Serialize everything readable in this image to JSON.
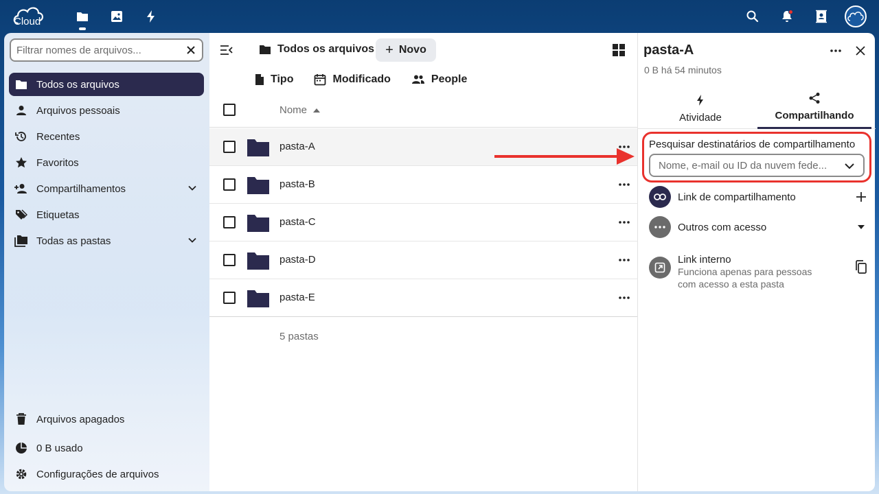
{
  "app": {
    "logo_text": "Cloud",
    "colors": {
      "accent": "#2b2a4e",
      "header": "#0b3d73",
      "highlight": "#e9322d"
    }
  },
  "topbar": {
    "apps": [
      "files-icon",
      "photos-icon",
      "activity-icon"
    ],
    "right": [
      "search-icon",
      "notifications-icon",
      "contacts-icon",
      "avatar"
    ]
  },
  "sidebar": {
    "filter_placeholder": "Filtrar nomes de arquivos...",
    "items": [
      {
        "label": "Todos os arquivos",
        "icon": "folder-icon",
        "active": true
      },
      {
        "label": "Arquivos pessoais",
        "icon": "person-icon"
      },
      {
        "label": "Recentes",
        "icon": "history-icon"
      },
      {
        "label": "Favoritos",
        "icon": "star-icon"
      },
      {
        "label": "Compartilhamentos",
        "icon": "share-person-icon",
        "expandable": true
      },
      {
        "label": "Etiquetas",
        "icon": "tag-icon"
      },
      {
        "label": "Todas as pastas",
        "icon": "folders-icon",
        "expandable": true
      }
    ],
    "footer": [
      {
        "label": "Arquivos apagados",
        "icon": "trash-icon"
      },
      {
        "label": "0 B usado",
        "icon": "pie-chart-icon"
      },
      {
        "label": "Configurações de arquivos",
        "icon": "gear-icon"
      }
    ]
  },
  "main": {
    "breadcrumb": "Todos os arquivos",
    "new_label": "Novo",
    "filters": [
      "Tipo",
      "Modificado",
      "People"
    ],
    "column_name": "Nome",
    "rows": [
      "pasta-A",
      "pasta-B",
      "pasta-C",
      "pasta-D",
      "pasta-E"
    ],
    "summary": "5 pastas"
  },
  "panel": {
    "title": "pasta-A",
    "subtitle": "0 B há 54 minutos",
    "tabs": [
      "Atividade",
      "Compartilhando"
    ],
    "active_tab": "Compartilhando",
    "share_search_label": "Pesquisar destinatários de compartilhamento",
    "share_search_placeholder": "Nome, e-mail ou ID da nuvem fede...",
    "share_link_label": "Link de compartilhamento",
    "others_label": "Outros com acesso",
    "internal_link_label": "Link interno",
    "internal_link_desc_1": "Funciona apenas para pessoas",
    "internal_link_desc_2": "com acesso a esta pasta"
  }
}
